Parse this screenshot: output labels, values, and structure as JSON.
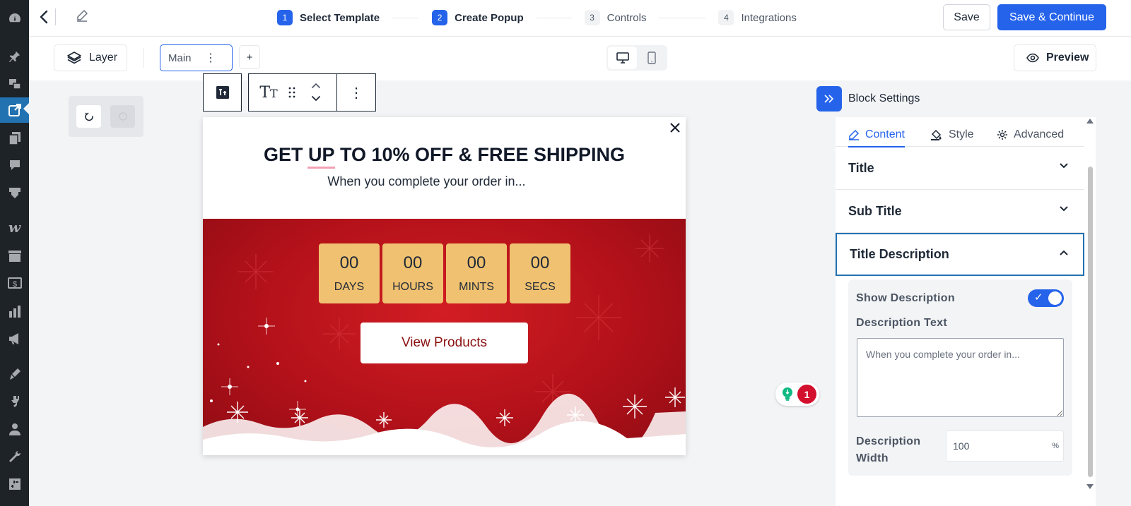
{
  "header": {
    "steps": [
      {
        "num": "1",
        "label": "Select Template"
      },
      {
        "num": "2",
        "label": "Create Popup"
      },
      {
        "num": "3",
        "label": "Controls"
      },
      {
        "num": "4",
        "label": "Integrations"
      }
    ],
    "save_label": "Save",
    "save_continue_label": "Save & Continue"
  },
  "toolbar": {
    "layer_label": "Layer",
    "main_tab_label": "Main",
    "add_tab_label": "+",
    "preview_label": "Preview"
  },
  "popup": {
    "title_before": "GET ",
    "title_up": "UP",
    "title_after": " TO 10% OFF & FREE SHIPPING",
    "subtitle": "When you complete your order in...",
    "countdown": [
      {
        "value": "00",
        "label": "DAYS"
      },
      {
        "value": "00",
        "label": "HOURS"
      },
      {
        "value": "00",
        "label": "MINTS"
      },
      {
        "value": "00",
        "label": "SECS"
      }
    ],
    "button_label": "View Products"
  },
  "badge": {
    "count": "1"
  },
  "panel": {
    "title": "Block Settings",
    "tabs": [
      {
        "label": "Content",
        "icon": "pencil-icon"
      },
      {
        "label": "Style",
        "icon": "paint-bucket-icon"
      },
      {
        "label": "Advanced",
        "icon": "gear-icon"
      }
    ],
    "accordions": {
      "title": "Title",
      "subtitle": "Sub Title",
      "title_description": "Title Description"
    },
    "show_description_label": "Show Description",
    "show_description_on": true,
    "description_text_label": "Description Text",
    "description_text_value": "When you complete your order in...",
    "description_width_label_1": "Description",
    "description_width_label_2": "Width",
    "description_width_value": "100",
    "description_width_unit": "%"
  },
  "colors": {
    "accent": "#2563eb",
    "countdown_bg": "#f0c170",
    "hero_red": "#c0141c",
    "button_text": "#8b1010"
  }
}
